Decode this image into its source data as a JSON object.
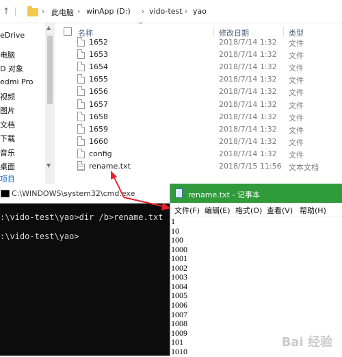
{
  "explorer": {
    "breadcrumb": [
      "此电脑",
      "winApp (D:)",
      "vido-test",
      "yao"
    ],
    "nav_items": [
      "eDrive",
      "电脑",
      "D 对象",
      "edmi Pro",
      "视频",
      "图片",
      "文档",
      "下载",
      "音乐",
      "桌面",
      "项目"
    ],
    "columns": {
      "name": "名称",
      "date": "修改日期",
      "type": "类型"
    },
    "files": [
      {
        "name": "1652",
        "date": "2018/7/14 1:32",
        "type": "文件"
      },
      {
        "name": "1653",
        "date": "2018/7/14 1:32",
        "type": "文件"
      },
      {
        "name": "1654",
        "date": "2018/7/14 1:32",
        "type": "文件"
      },
      {
        "name": "1655",
        "date": "2018/7/14 1:32",
        "type": "文件"
      },
      {
        "name": "1656",
        "date": "2018/7/14 1:32",
        "type": "文件"
      },
      {
        "name": "1657",
        "date": "2018/7/14 1:32",
        "type": "文件"
      },
      {
        "name": "1658",
        "date": "2018/7/14 1:32",
        "type": "文件"
      },
      {
        "name": "1659",
        "date": "2018/7/14 1:32",
        "type": "文件"
      },
      {
        "name": "1660",
        "date": "2018/7/14 1:32",
        "type": "文件"
      },
      {
        "name": "config",
        "date": "2018/7/14 1:32",
        "type": "文件"
      },
      {
        "name": "rename.txt",
        "date": "2018/7/15 11:56",
        "type": "文本文档"
      }
    ]
  },
  "cmd": {
    "title": "C:\\WINDOWS\\system32\\cmd.exe",
    "lines": [
      ":\\vido-test\\yao>dir /b>rename.txt",
      ":\\vido-test\\yao>"
    ]
  },
  "notepad": {
    "title": "rename.txt - 记事本",
    "menu": [
      "文件(F)",
      "编辑(E)",
      "格式(O)",
      "查看(V)",
      "帮助(H)"
    ],
    "lines": [
      "1",
      "10",
      "100",
      "1000",
      "1001",
      "1002",
      "1003",
      "1004",
      "1005",
      "1006",
      "1007",
      "1008",
      "1009",
      "101",
      "1010"
    ]
  },
  "watermark": "Bai 经验",
  "colors": {
    "notepad_title": "#2f9b3a",
    "annotation": "#e8212b",
    "header_text": "#4d6082"
  }
}
